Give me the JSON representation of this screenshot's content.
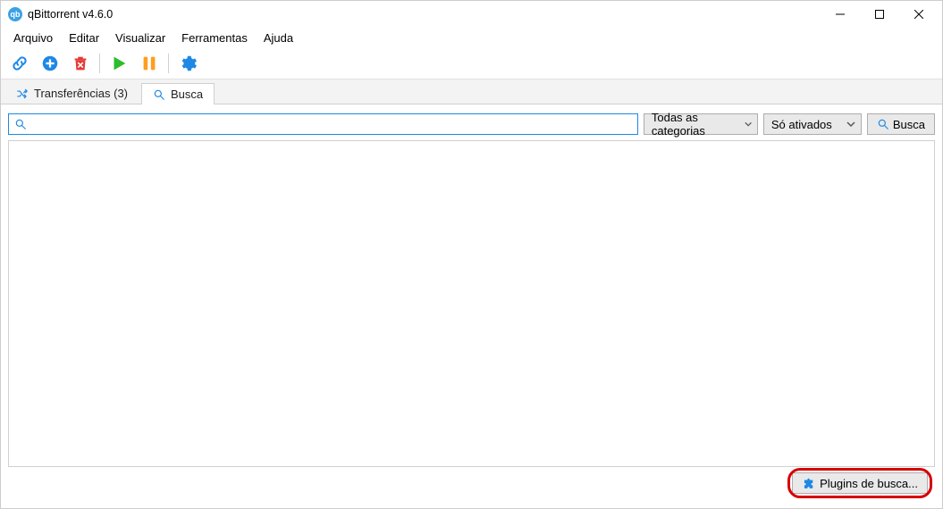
{
  "app": {
    "title": "qBittorrent v4.6.0",
    "icon_label": "qb"
  },
  "menu": {
    "file": "Arquivo",
    "edit": "Editar",
    "view": "Visualizar",
    "tools": "Ferramentas",
    "help": "Ajuda"
  },
  "tabs": {
    "transfers": "Transferências (3)",
    "search": "Busca"
  },
  "search": {
    "placeholder": "",
    "value": "",
    "category_label": "Todas as categorias",
    "status_label": "Só ativados",
    "search_button": "Busca",
    "plugins_button": "Plugins de busca..."
  },
  "colors": {
    "accent": "#1e88e5",
    "play": "#2bbd2b",
    "pause": "#ff9d1f",
    "delete": "#e53935",
    "gear": "#1e88e5"
  }
}
